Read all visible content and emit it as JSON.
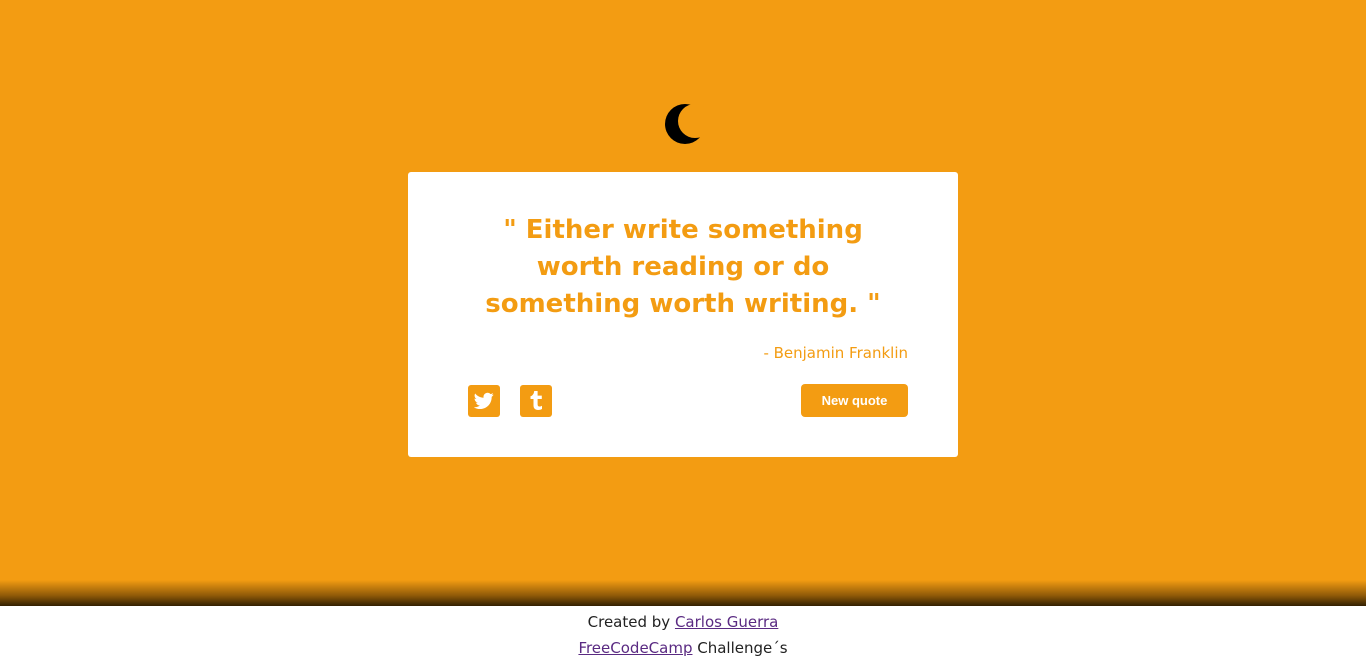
{
  "colors": {
    "accent": "#f39c12",
    "card": "#ffffff",
    "icon": "#000000"
  },
  "header": {
    "icon": "moon-icon"
  },
  "quote": {
    "text": "\" Either write something worth reading or do something worth writing. \"",
    "author": "- Benjamin Franklin"
  },
  "actions": {
    "twitter_icon": "twitter-icon",
    "tumblr_icon": "tumblr-icon",
    "new_quote_label": "New quote"
  },
  "footer": {
    "created_by": "Created by ",
    "author_link": "Carlos Guerra",
    "fcc_link": "FreeCodeCamp",
    "challenges": " Challenge´s"
  }
}
